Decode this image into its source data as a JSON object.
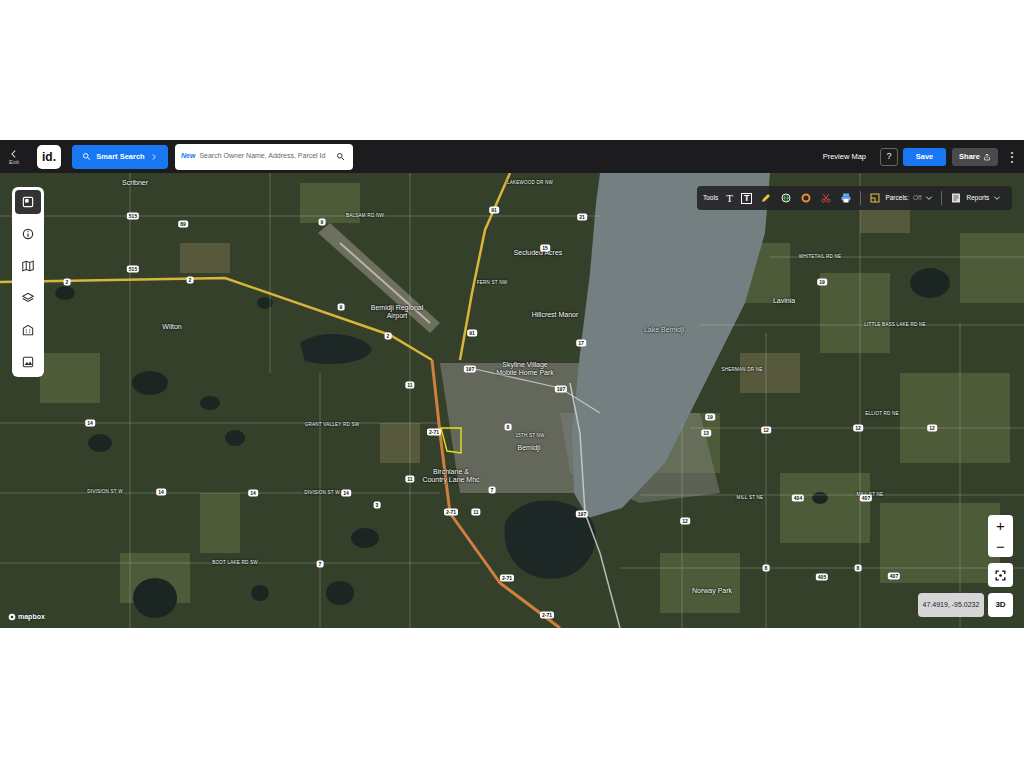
{
  "topbar": {
    "exit": "Exit",
    "logo": "id.",
    "smart_search": "Smart Search",
    "search": {
      "badge": "New",
      "placeholder": "Search Owner Name, Address, Parcel Id"
    },
    "preview": "Preview Map",
    "help": "?",
    "save": "Save",
    "share": "Share",
    "more": "⋮"
  },
  "tools": {
    "label": "Tools",
    "text_tool": "T",
    "text_box_tool": "T",
    "parcels": {
      "label": "Parcels:",
      "value": "Off"
    },
    "reports": "Reports"
  },
  "controls": {
    "zoom_in": "+",
    "zoom_out": "−",
    "coordinates": "47.4919, -95.0232",
    "view_3d": "3D",
    "attribution": "mapbox"
  },
  "map": {
    "places": [
      "Scribner",
      "Wilton",
      "Bemidji Regional Airport",
      "Hillcrest Manor",
      "Secluded Acres",
      "Skyline Village Mobile Home Park",
      "Bemidji",
      "Birchlane & Country Lane Mhc",
      "Lavinia",
      "Norway Park"
    ],
    "lake": "Lake Bemidji",
    "roads": [
      "BALSAM RD NW",
      "FERN ST NW",
      "LAKEWOOD DR NW",
      "15TH ST NW",
      "GRANT VALLEY RD SW",
      "DIVISION ST W",
      "DIVISION ST W",
      "BOOT LAKE RD SW",
      "WHITETAIL RD NE",
      "LITTLE BASS LAKE RD NE",
      "ELLIOT RD NE",
      "SHERMAN DR NE",
      "MILL ST NE",
      "MILL ST NE"
    ],
    "shields": [
      "2",
      "2",
      "89",
      "515",
      "515",
      "9",
      "9",
      "2",
      "91",
      "21",
      "15",
      "91",
      "197",
      "11",
      "197",
      "17",
      "2-71",
      "8",
      "11",
      "7",
      "14",
      "14",
      "14",
      "14",
      "3",
      "2-71",
      "11",
      "7",
      "2-71",
      "2-71",
      "197",
      "12",
      "8",
      "405",
      "8",
      "407",
      "404",
      "407",
      "12",
      "12",
      "12",
      "13",
      "19",
      "19"
    ]
  }
}
